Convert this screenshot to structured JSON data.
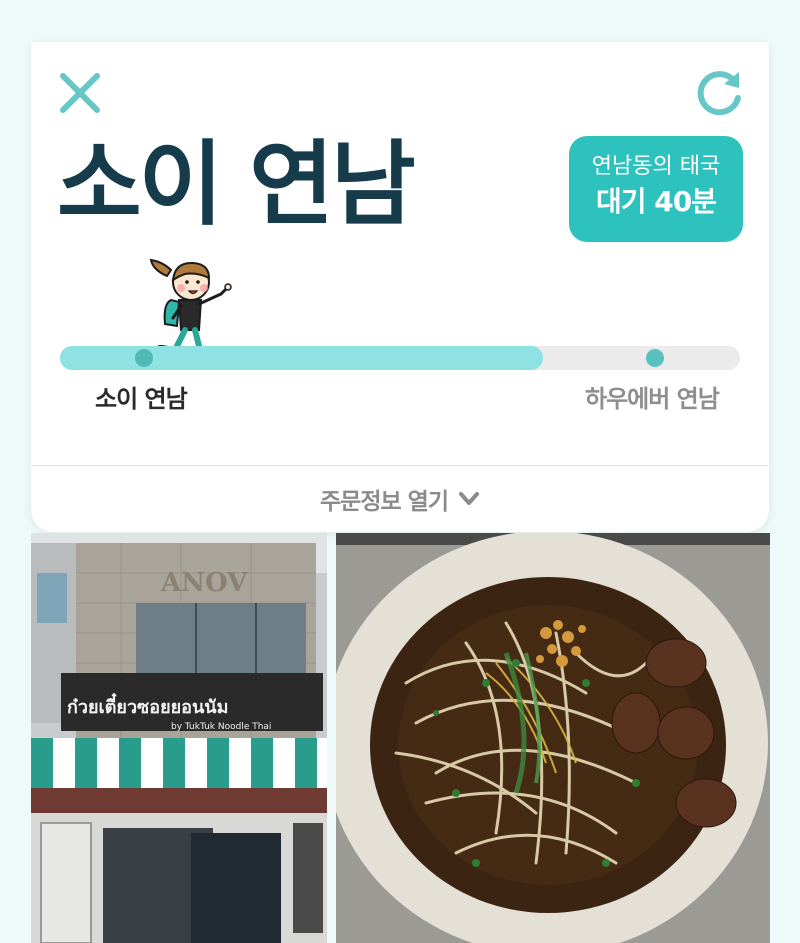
{
  "header": {
    "close_icon": "close-icon",
    "refresh_icon": "refresh-icon",
    "title": "소이 연남"
  },
  "badge": {
    "line1": "연남동의 태국",
    "line2": "대기 40분"
  },
  "progress": {
    "fraction": 0.71,
    "start_label": "소이 연남",
    "end_label": "하우에버 연남"
  },
  "order": {
    "label": "주문정보 열기",
    "icon": "chevron-down-icon"
  },
  "photos": {
    "shop_sign_text": "ก๋วยเตี๋ยวซอยยอนนัม",
    "shop_sign_sub": "by TukTuk Noodle Thai",
    "shop_logo": "ANOV"
  },
  "colors": {
    "accent": "#2ec2be",
    "progress_fill": "#8ee3e2",
    "title": "#163c4c",
    "background": "#eef9fa"
  }
}
